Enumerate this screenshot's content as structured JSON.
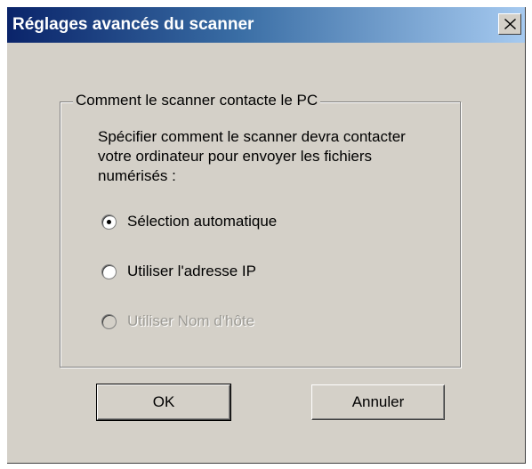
{
  "window": {
    "title": "Réglages avancés du scanner"
  },
  "group": {
    "label": "Comment le scanner contacte le PC",
    "description": "Spécifier comment le scanner devra contacter votre ordinateur pour envoyer les fichiers numérisés :",
    "options": [
      {
        "label": "Sélection automatique",
        "selected": true,
        "enabled": true
      },
      {
        "label": "Utiliser l'adresse IP",
        "selected": false,
        "enabled": true
      },
      {
        "label": "Utiliser Nom d'hôte",
        "selected": false,
        "enabled": false
      }
    ]
  },
  "buttons": {
    "ok_label": "OK",
    "cancel_label": "Annuler"
  },
  "icons": {
    "close": "close-icon",
    "radio_selected": "radio-selected-icon",
    "radio_unselected": "radio-unselected-icon"
  },
  "colors": {
    "titlebar_start": "#0a246a",
    "titlebar_end": "#a6caf0",
    "face": "#d4d0c8",
    "disabled_text": "#9c9a94"
  }
}
